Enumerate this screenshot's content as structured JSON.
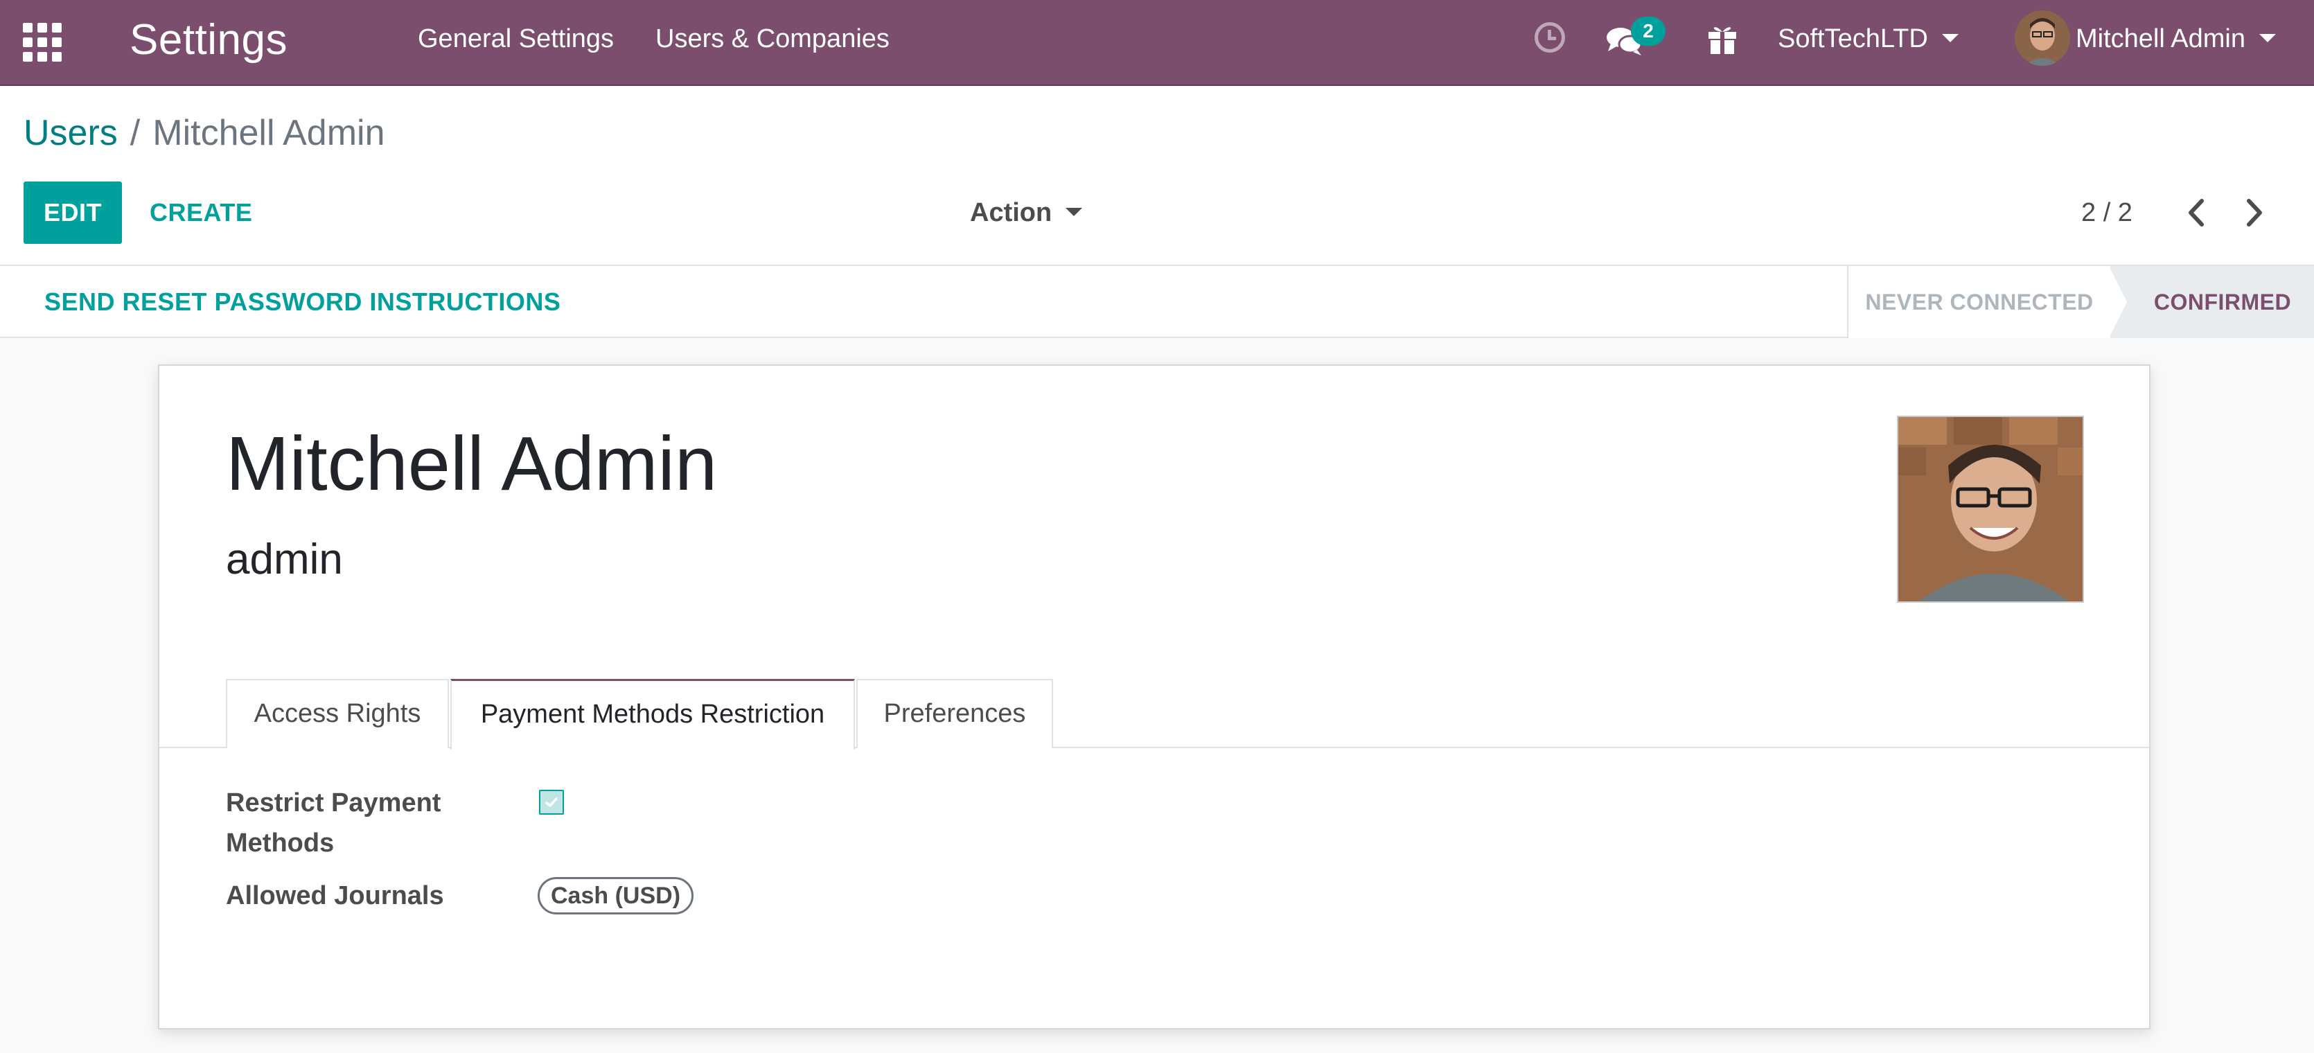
{
  "navbar": {
    "app_title": "Settings",
    "menus": [
      {
        "label": "General Settings"
      },
      {
        "label": "Users & Companies"
      }
    ],
    "chat_badge": "2",
    "company": "SoftTechLTD",
    "user": "Mitchell Admin",
    "icons": [
      "apps-grid-icon",
      "clock-icon",
      "chat-icon",
      "gift-icon",
      "user-avatar"
    ]
  },
  "breadcrumb": {
    "parent": "Users",
    "separator": "/",
    "current": "Mitchell Admin"
  },
  "toolbar": {
    "edit_label": "EDIT",
    "create_label": "CREATE",
    "action_label": "Action",
    "pager_value": "2 / 2"
  },
  "statusbar": {
    "reset_password_label": "SEND RESET PASSWORD INSTRUCTIONS",
    "stages": [
      {
        "label": "NEVER CONNECTED",
        "active": false
      },
      {
        "label": "CONFIRMED",
        "active": true
      }
    ]
  },
  "record": {
    "name": "Mitchell Admin",
    "login": "admin"
  },
  "tabs": [
    {
      "label": "Access Rights",
      "active": false
    },
    {
      "label": "Payment Methods Restriction",
      "active": true
    },
    {
      "label": "Preferences",
      "active": false
    }
  ],
  "fields": {
    "restrict_payment_label_line1": "Restrict Payment",
    "restrict_payment_label_line2": "Methods",
    "restrict_payment_checked": true,
    "allowed_journals_label": "Allowed Journals",
    "allowed_journals_tags": [
      "Cash (USD)"
    ]
  },
  "colors": {
    "navbar": "#7c4e6e",
    "primary": "#00a09d",
    "link": "#017e84",
    "active_stage": "#7c4e6e"
  }
}
